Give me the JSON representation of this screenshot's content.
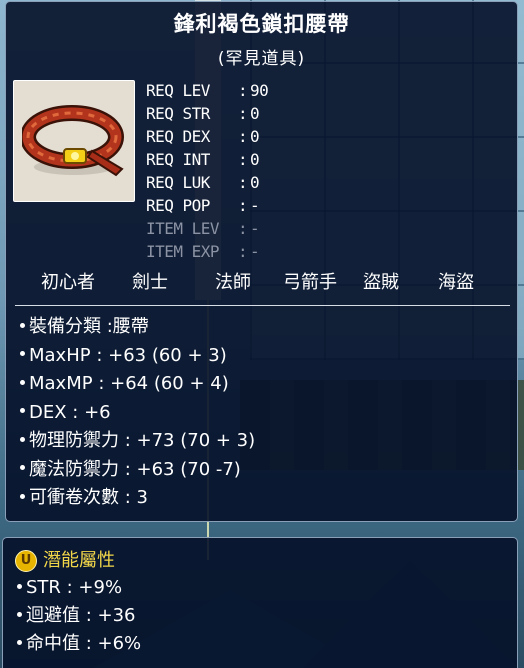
{
  "item": {
    "name": "鋒利褐色鎖扣腰帶",
    "rarity": "(罕見道具)",
    "icon": "brown-buckle-belt-icon"
  },
  "requirements": [
    {
      "label": "REQ LEV",
      "value": "90",
      "dim": false
    },
    {
      "label": "REQ STR",
      "value": "0",
      "dim": false
    },
    {
      "label": "REQ DEX",
      "value": "0",
      "dim": false
    },
    {
      "label": "REQ INT",
      "value": "0",
      "dim": false
    },
    {
      "label": "REQ LUK",
      "value": "0",
      "dim": false
    },
    {
      "label": "REQ POP",
      "value": "-",
      "dim": false
    },
    {
      "label": "ITEM LEV",
      "value": "-",
      "dim": true
    },
    {
      "label": "ITEM EXP",
      "value": "-",
      "dim": true
    }
  ],
  "jobs": [
    "初心者",
    "劍士",
    "法師",
    "弓箭手",
    "盜賊",
    "海盜"
  ],
  "stats": [
    "裝備分類 :腰帶",
    "MaxHP : +63 (60 + 3)",
    "MaxMP : +64 (60 + 4)",
    "DEX : +6",
    "物理防禦力 : +73 (70 + 3)",
    "魔法防禦力 : +63 (70 -7)",
    "可衝卷次數 : 3"
  ],
  "potential": {
    "icon_letter": "U",
    "title": "潛能屬性",
    "lines": [
      "STR : +9%",
      "迴避值 : +36",
      "命中值 : +6%"
    ]
  },
  "colors": {
    "panel_bg": "#04102 8",
    "potential_title": "#f2d64a",
    "dim_text": "#8b93a4"
  }
}
